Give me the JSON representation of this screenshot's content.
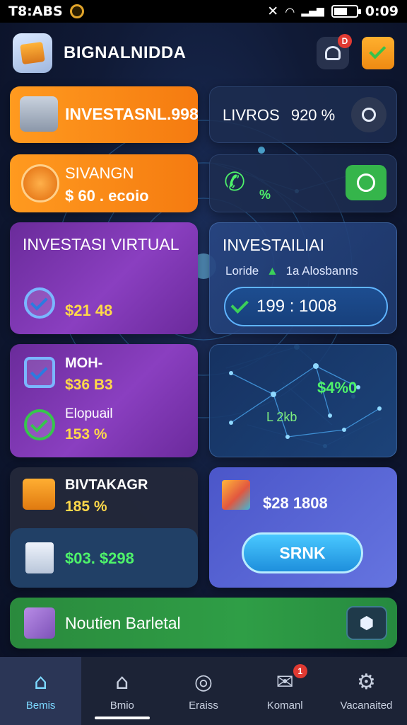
{
  "status": {
    "time_left": "T8:ABS",
    "time_right": "0:09"
  },
  "header": {
    "title": "BIGNALNIDDA",
    "notif_badge": "D"
  },
  "cards": {
    "c1": {
      "text": "INVESTASNL.998"
    },
    "c2": {
      "label": "LIVROS",
      "value": "920 %"
    },
    "c3": {
      "title": "SIVANGN",
      "value": "$ 60 . ecoio"
    },
    "c4": {
      "value": "%"
    },
    "c5": {
      "title": "INVESTASI VIRTUAL",
      "value": "$21 48"
    },
    "c6": {
      "title": "INVESTAILIAI",
      "sub_left": "Loride",
      "sub_right": "1a Alosbanns",
      "pill_value": "199 : 1008"
    },
    "c7": {
      "title": "MOH-",
      "value1": "$36 B3",
      "label2": "Elopuail",
      "value2": "153 %"
    },
    "c8": {
      "value1": "$4%0",
      "value2": "L 2kb"
    },
    "c9": {
      "title": "BIVTAKAGR",
      "value": "185 %"
    },
    "c10": {
      "value": "$28 1808",
      "button": "SRNK"
    },
    "c11": {
      "value": "$03. $298"
    },
    "c12": {
      "text": "Noutien Barletal"
    }
  },
  "nav": [
    {
      "label": "Bemis",
      "glyph": "⌂",
      "icon": "home-icon"
    },
    {
      "label": "Bmio",
      "glyph": "⌂",
      "icon": "house-icon"
    },
    {
      "label": "Eraiss",
      "glyph": "◎",
      "icon": "badge-icon"
    },
    {
      "label": "Komanl",
      "glyph": "✉",
      "icon": "mail-icon",
      "badge": "1"
    },
    {
      "label": "Vacanaited",
      "glyph": "⚙",
      "icon": "gear-icon"
    }
  ],
  "colors": {
    "accent": "#f57b10",
    "purple": "#8a3fc0",
    "blue": "#1e8fdc",
    "green": "#2f9e46"
  }
}
